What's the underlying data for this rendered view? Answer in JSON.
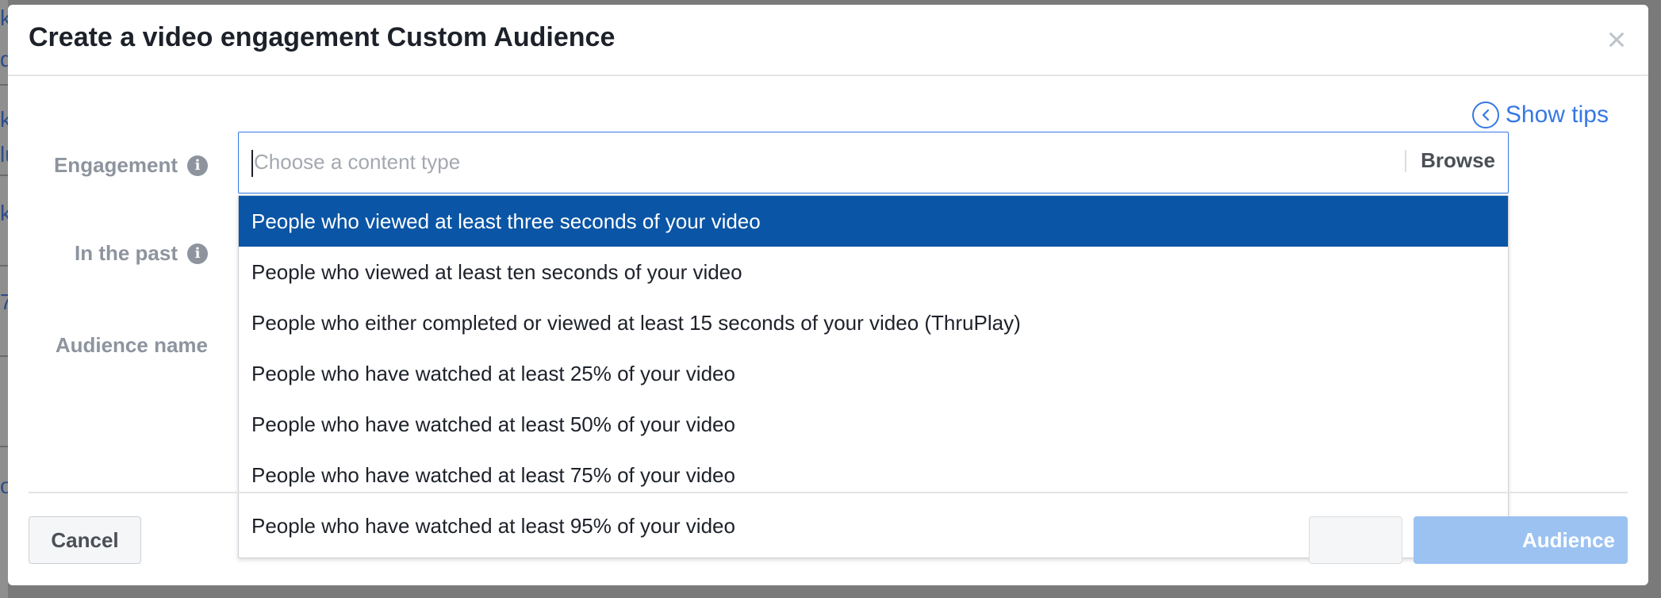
{
  "modal": {
    "title": "Create a video engagement Custom Audience",
    "close_glyph": "×",
    "show_tips_label": "Show tips"
  },
  "form": {
    "engagement_label": "Engagement",
    "in_the_past_label": "In the past",
    "audience_name_label": "Audience name",
    "content_type_input": {
      "value": "",
      "placeholder": "Choose a content type",
      "browse_label": "Browse"
    }
  },
  "dropdown": {
    "selected_index": 0,
    "options": [
      "People who viewed at least three seconds of your video",
      "People who viewed at least ten seconds of your video",
      "People who either completed or viewed at least 15 seconds of your video (ThruPlay)",
      "People who have watched at least 25% of your video",
      "People who have watched at least 50% of your video",
      "People who have watched at least 75% of your video",
      "People who have watched at least 95% of your video"
    ]
  },
  "footer": {
    "cancel_label": "Cancel",
    "create_label_visible": "Audience"
  },
  "icons": {
    "close": "close-icon",
    "tips": "chevron-left-circle-icon",
    "info": "info-icon"
  },
  "colors": {
    "accent": "#3578e5",
    "selected_row": "#0a55a5",
    "label_gray": "#8d949e",
    "primary_disabled": "#9cc2f2"
  }
}
